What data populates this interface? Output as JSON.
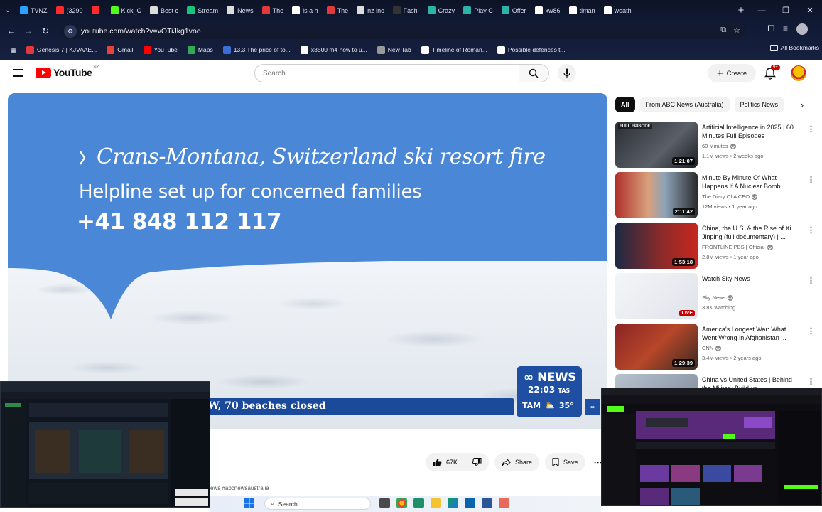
{
  "browser": {
    "tabs": [
      {
        "label": "TVNZ",
        "color": "#2aa0ff"
      },
      {
        "label": "(3290",
        "color": "#ff2a2a"
      },
      {
        "label": "",
        "color": "#ff2a2a"
      },
      {
        "label": "Kick_C",
        "color": "#53fc18"
      },
      {
        "label": "Best c",
        "color": "#dddddd"
      },
      {
        "label": "Stream",
        "color": "#18c47a"
      },
      {
        "label": "News",
        "color": "#dddddd"
      },
      {
        "label": "The",
        "color": "#e23a3a"
      },
      {
        "label": "is a h",
        "color": "#ffffff"
      },
      {
        "label": "The",
        "color": "#e23a3a"
      },
      {
        "label": "nz inc",
        "color": "#dddddd"
      },
      {
        "label": "Fashi",
        "color": "#333333"
      },
      {
        "label": "Crazy",
        "color": "#2cb2a6"
      },
      {
        "label": "Play C",
        "color": "#2cb2a6"
      },
      {
        "label": "Offer",
        "color": "#2cb2a6"
      },
      {
        "label": "xw86",
        "color": "#ffffff"
      },
      {
        "label": "timan",
        "color": "#ffffff"
      },
      {
        "label": "weath",
        "color": "#ffffff"
      }
    ],
    "url": "youtube.com/watch?v=vOTiJkg1voo",
    "bookmarks": [
      {
        "label": "Genesis 7 | KJVAAE...",
        "color": "#e23a3a"
      },
      {
        "label": "Gmail",
        "color": "#ea4335"
      },
      {
        "label": "YouTube",
        "color": "#ff0000"
      },
      {
        "label": "Maps",
        "color": "#34a853"
      },
      {
        "label": "13.3 The price of to...",
        "color": "#3b6fd6"
      },
      {
        "label": "x3500 m4 how to u...",
        "color": "#ffffff"
      },
      {
        "label": "New Tab",
        "color": "#999999"
      },
      {
        "label": "Timeline of Roman...",
        "color": "#ffffff"
      },
      {
        "label": "Possible defences t...",
        "color": "#ffffff"
      }
    ],
    "all_bookmarks": "All Bookmarks"
  },
  "youtube": {
    "logo_text": "YouTube",
    "country": "NZ",
    "search_placeholder": "Search",
    "create_label": "Create",
    "notif_count": "9+"
  },
  "video": {
    "title": "Crans-Montana, Switzerland ski resort fire",
    "subtitle": "Helpline set up for concerned families",
    "phone": "+41 848 112 117",
    "ticker": "W, 70 beaches closed",
    "abc_logo": "NEWS",
    "abc_time": "22:03",
    "abc_tz": "TAS",
    "weather_city": "TAM",
    "weather_temp": "35°",
    "likes": "67K",
    "share_label": "Share",
    "save_label": "Save",
    "hashtags": "ews #abcnewsaustralia"
  },
  "chips": [
    "All",
    "From ABC News (Australia)",
    "Politics News"
  ],
  "recommendations": [
    {
      "title": "Artificial Intelligence in 2025 | 60 Minutes Full Episodes",
      "channel": "60 Minutes",
      "verified": true,
      "meta": "1.1M views • 2 weeks ago",
      "duration": "1:21:07",
      "badge": "FULL EPISODE",
      "live": false,
      "thumb": "linear-gradient(135deg,#2a2d33,#5a5f68 60%,#1a1c20)"
    },
    {
      "title": "Minute By Minute Of What Happens If A Nuclear Bomb ...",
      "channel": "The Diary Of A CEO",
      "verified": true,
      "meta": "12M views • 1 year ago",
      "duration": "2:11:42",
      "badge": "",
      "live": false,
      "thumb": "linear-gradient(90deg,#b0302a,#d9a07c 40%,#8da3b8 60%,#2b2b2b)"
    },
    {
      "title": "China, the U.S. & the Rise of Xi Jinping (full documentary) | ...",
      "channel": "FRONTLINE PBS | Official",
      "verified": true,
      "meta": "2.8M views • 1 year ago",
      "duration": "1:53:18",
      "badge": "",
      "live": false,
      "thumb": "linear-gradient(90deg,#1d2a44,#8a2a2a 55%,#c6281f)"
    },
    {
      "title": "Watch Sky News",
      "channel": "Sky News",
      "verified": true,
      "meta": "3.8K watching",
      "duration": "LIVE",
      "badge": "",
      "live": true,
      "thumb": "linear-gradient(135deg,#f4f5f8,#dfe3ea)"
    },
    {
      "title": "America's Longest War: What Went Wrong in Afghanistan ...",
      "channel": "CNN",
      "verified": true,
      "meta": "3.4M views • 2 years ago",
      "duration": "1:29:39",
      "badge": "",
      "live": false,
      "thumb": "linear-gradient(135deg,#8a2323,#b7472a 50%,#3a2a20)"
    },
    {
      "title": "China vs United States | Behind the Military Build-up",
      "channel": "",
      "verified": false,
      "meta": "",
      "duration": "",
      "badge": "",
      "live": false,
      "thumb": "linear-gradient(135deg,#b7c2cf,#7d8a99)"
    }
  ],
  "taskbar": {
    "search_label": "Search"
  }
}
